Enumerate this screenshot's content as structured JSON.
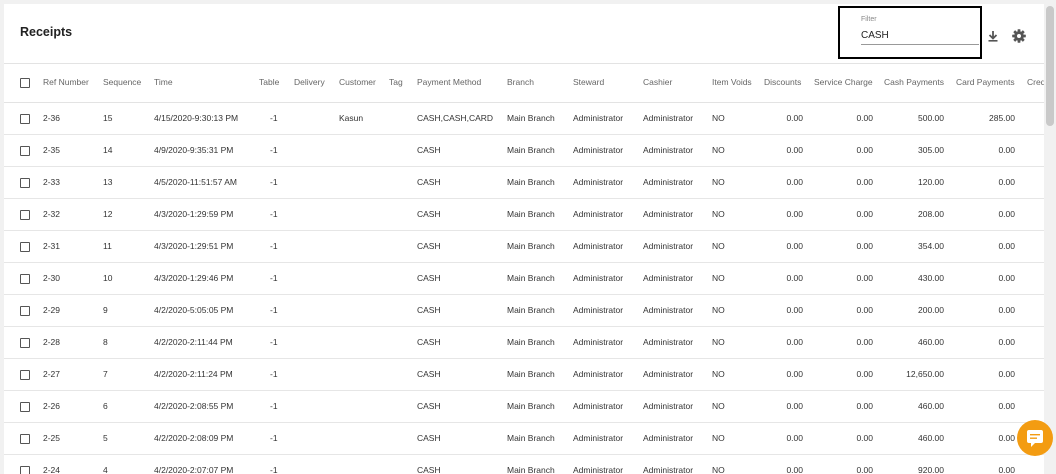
{
  "page": {
    "title": "Receipts"
  },
  "filter": {
    "label": "Filter",
    "value": "CASH"
  },
  "icons": {
    "download": "download-icon",
    "settings": "gear-icon",
    "chat": "chat-icon"
  },
  "colors": {
    "accent": "#f39c12",
    "frame": "#000000"
  },
  "table": {
    "headers": [
      "Ref Number",
      "Sequence",
      "Time",
      "Table",
      "Delivery",
      "Customer",
      "Tag",
      "Payment Method",
      "Branch",
      "Steward",
      "Cashier",
      "Item Voids",
      "Discounts",
      "Service Charge",
      "Cash Payments",
      "Card Payments",
      "Cred"
    ],
    "rows": [
      {
        "ref": "2-36",
        "seq": "15",
        "time": "4/15/2020-9:30:13 PM",
        "table": "-1",
        "delivery": "",
        "customer": "Kasun",
        "tag": "",
        "payment": "CASH,CASH,CARD",
        "branch": "Main Branch",
        "steward": "Administrator",
        "cashier": "Administrator",
        "voids": "NO",
        "discounts": "0.00",
        "service": "0.00",
        "cash": "500.00",
        "card": "285.00"
      },
      {
        "ref": "2-35",
        "seq": "14",
        "time": "4/9/2020-9:35:31 PM",
        "table": "-1",
        "delivery": "",
        "customer": "",
        "tag": "",
        "payment": "CASH",
        "branch": "Main Branch",
        "steward": "Administrator",
        "cashier": "Administrator",
        "voids": "NO",
        "discounts": "0.00",
        "service": "0.00",
        "cash": "305.00",
        "card": "0.00"
      },
      {
        "ref": "2-33",
        "seq": "13",
        "time": "4/5/2020-11:51:57 AM",
        "table": "-1",
        "delivery": "",
        "customer": "",
        "tag": "",
        "payment": "CASH",
        "branch": "Main Branch",
        "steward": "Administrator",
        "cashier": "Administrator",
        "voids": "NO",
        "discounts": "0.00",
        "service": "0.00",
        "cash": "120.00",
        "card": "0.00"
      },
      {
        "ref": "2-32",
        "seq": "12",
        "time": "4/3/2020-1:29:59 PM",
        "table": "-1",
        "delivery": "",
        "customer": "",
        "tag": "",
        "payment": "CASH",
        "branch": "Main Branch",
        "steward": "Administrator",
        "cashier": "Administrator",
        "voids": "NO",
        "discounts": "0.00",
        "service": "0.00",
        "cash": "208.00",
        "card": "0.00"
      },
      {
        "ref": "2-31",
        "seq": "11",
        "time": "4/3/2020-1:29:51 PM",
        "table": "-1",
        "delivery": "",
        "customer": "",
        "tag": "",
        "payment": "CASH",
        "branch": "Main Branch",
        "steward": "Administrator",
        "cashier": "Administrator",
        "voids": "NO",
        "discounts": "0.00",
        "service": "0.00",
        "cash": "354.00",
        "card": "0.00"
      },
      {
        "ref": "2-30",
        "seq": "10",
        "time": "4/3/2020-1:29:46 PM",
        "table": "-1",
        "delivery": "",
        "customer": "",
        "tag": "",
        "payment": "CASH",
        "branch": "Main Branch",
        "steward": "Administrator",
        "cashier": "Administrator",
        "voids": "NO",
        "discounts": "0.00",
        "service": "0.00",
        "cash": "430.00",
        "card": "0.00"
      },
      {
        "ref": "2-29",
        "seq": "9",
        "time": "4/2/2020-5:05:05 PM",
        "table": "-1",
        "delivery": "",
        "customer": "",
        "tag": "",
        "payment": "CASH",
        "branch": "Main Branch",
        "steward": "Administrator",
        "cashier": "Administrator",
        "voids": "NO",
        "discounts": "0.00",
        "service": "0.00",
        "cash": "200.00",
        "card": "0.00"
      },
      {
        "ref": "2-28",
        "seq": "8",
        "time": "4/2/2020-2:11:44 PM",
        "table": "-1",
        "delivery": "",
        "customer": "",
        "tag": "",
        "payment": "CASH",
        "branch": "Main Branch",
        "steward": "Administrator",
        "cashier": "Administrator",
        "voids": "NO",
        "discounts": "0.00",
        "service": "0.00",
        "cash": "460.00",
        "card": "0.00"
      },
      {
        "ref": "2-27",
        "seq": "7",
        "time": "4/2/2020-2:11:24 PM",
        "table": "-1",
        "delivery": "",
        "customer": "",
        "tag": "",
        "payment": "CASH",
        "branch": "Main Branch",
        "steward": "Administrator",
        "cashier": "Administrator",
        "voids": "NO",
        "discounts": "0.00",
        "service": "0.00",
        "cash": "12,650.00",
        "card": "0.00"
      },
      {
        "ref": "2-26",
        "seq": "6",
        "time": "4/2/2020-2:08:55 PM",
        "table": "-1",
        "delivery": "",
        "customer": "",
        "tag": "",
        "payment": "CASH",
        "branch": "Main Branch",
        "steward": "Administrator",
        "cashier": "Administrator",
        "voids": "NO",
        "discounts": "0.00",
        "service": "0.00",
        "cash": "460.00",
        "card": "0.00"
      },
      {
        "ref": "2-25",
        "seq": "5",
        "time": "4/2/2020-2:08:09 PM",
        "table": "-1",
        "delivery": "",
        "customer": "",
        "tag": "",
        "payment": "CASH",
        "branch": "Main Branch",
        "steward": "Administrator",
        "cashier": "Administrator",
        "voids": "NO",
        "discounts": "0.00",
        "service": "0.00",
        "cash": "460.00",
        "card": "0.00"
      },
      {
        "ref": "2-24",
        "seq": "4",
        "time": "4/2/2020-2:07:07 PM",
        "table": "-1",
        "delivery": "",
        "customer": "",
        "tag": "",
        "payment": "CASH",
        "branch": "Main Branch",
        "steward": "Administrator",
        "cashier": "Administrator",
        "voids": "NO",
        "discounts": "0.00",
        "service": "0.00",
        "cash": "920.00",
        "card": "0.00"
      }
    ]
  }
}
